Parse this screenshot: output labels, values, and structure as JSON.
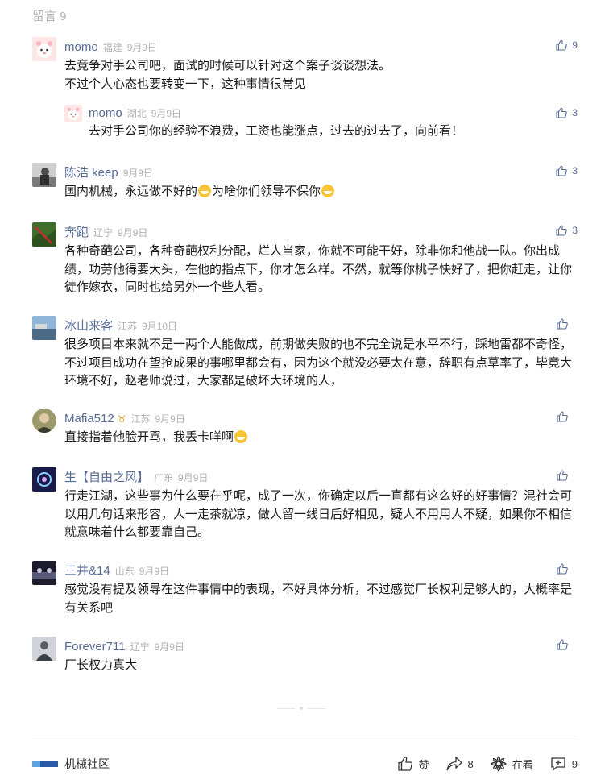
{
  "header": {
    "title": "留言 9"
  },
  "comments": [
    {
      "name": "momo",
      "loc": "福建",
      "date": "9月9日",
      "likes": "9",
      "lines": [
        "去竞争对手公司吧，面试的时候可以针对这个案子谈谈想法。",
        "不过个人心态也要转变一下，这种事情很常见"
      ]
    },
    {
      "name": "momo",
      "loc": "湖北",
      "date": "9月9日",
      "likes": "3",
      "lines": [
        "去对手公司你的经验不浪费，工资也能涨点，过去的过去了，向前看！"
      ]
    },
    {
      "name": "陈浩 keep",
      "loc": "",
      "date": "9月9日",
      "likes": "3",
      "text_a": "国内机械，永远做不好的",
      "text_b": "为啥你们领导不保你"
    },
    {
      "name": "奔跑",
      "loc": "辽宁",
      "date": "9月9日",
      "likes": "3",
      "lines": [
        "各种奇葩公司，各种奇葩权利分配，烂人当家，你就不可能干好，除非你和他战一队。你出成",
        "绩，功劳他得要大头，在他的指点下，你才怎么样。不然，就等你桃子快好了，把你赶走，让你",
        "徒作嫁衣，同时也给另外一个些人看。"
      ]
    },
    {
      "name": "冰山来客",
      "loc": "江苏",
      "date": "9月10日",
      "likes": "",
      "lines": [
        "很多项目本来就不是一两个人能做成，前期做失败的也不完全说是水平不行，踩地雷都不奇怪，",
        "不过项目成功在望抢成果的事哪里都会有，因为这个就没必要太在意，辞职有点草率了，毕竟大",
        "环境不好，赵老师说过，大家都是破坏大环境的人，"
      ]
    },
    {
      "name": "Mafia512",
      "badge": "♉",
      "loc": "江苏",
      "date": "9月9日",
      "likes": "",
      "text_a": "直接指着他脸开骂，我丢卡咩啊",
      "text_b": ""
    },
    {
      "name": "生【自由之风】",
      "loc": "广东",
      "date": "9月9日",
      "likes": "",
      "lines": [
        "行走江湖，这些事为什么要在乎呢，成了一次，你确定以后一直都有这么好的好事情？混社会可",
        "以用几句话来形容，人一走茶就凉，做人留一线日后好相见，疑人不用用人不疑，如果你不相信",
        "就意味着什么都要靠自己。"
      ]
    },
    {
      "name": "三井&14",
      "loc": "山东",
      "date": "9月9日",
      "likes": "",
      "lines": [
        "感觉没有提及领导在这件事情中的表现，不好具体分析，不过感觉厂长权利是够大的，大概率是",
        "有关系吧"
      ]
    },
    {
      "name": "Forever711",
      "loc": "辽宁",
      "date": "9月9日",
      "likes": "",
      "lines": [
        "厂长权力真大"
      ]
    }
  ],
  "footer": {
    "account": "机械社区",
    "like_label": "赞",
    "share_count": "8",
    "watching_label": "在看",
    "comment_count": "9"
  },
  "colors": {
    "name": "#576b95",
    "meta": "#b2b2b2",
    "badge": "#f0a030"
  }
}
